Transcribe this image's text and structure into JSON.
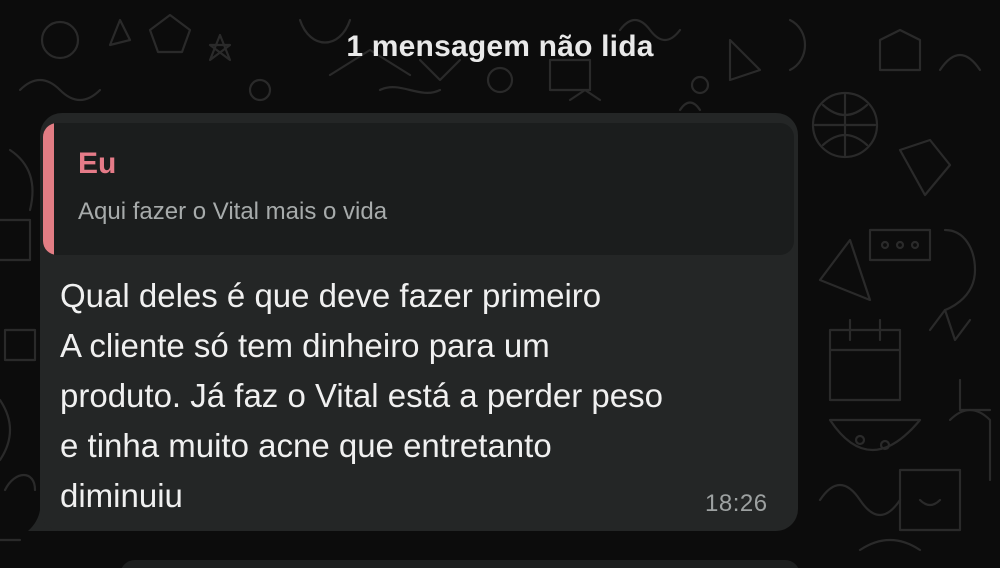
{
  "chat": {
    "unread_banner": "1 mensagem não lida"
  },
  "message": {
    "quote": {
      "author": "Eu",
      "text": "Aqui fazer o Vital mais o vida",
      "accent_color": "#e27d84"
    },
    "lines": [
      "Qual deles é que deve fazer primeiro",
      "A cliente só tem dinheiro para um",
      "produto. Já faz o Vital está a perder peso",
      "e tinha muito acne que entretanto",
      "diminuiu"
    ],
    "time": "18:26"
  },
  "colors": {
    "background": "#0c0c0c",
    "bubble": "#242626",
    "quote_background": "#1b1d1d",
    "text": "#f0f0f0"
  }
}
